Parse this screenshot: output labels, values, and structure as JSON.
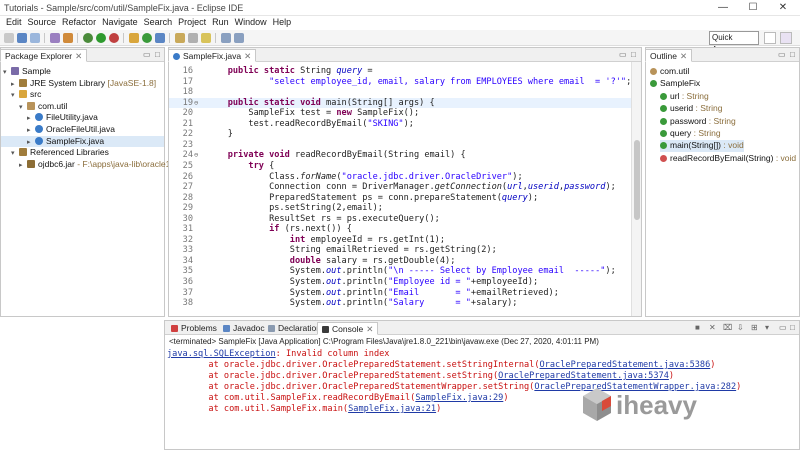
{
  "window": {
    "title": "Tutorials - Sample/src/com/util/SampleFix.java - Eclipse IDE",
    "controls": [
      "—",
      "☐",
      "✕"
    ]
  },
  "menu": [
    "Edit",
    "Source",
    "Refactor",
    "Navigate",
    "Search",
    "Project",
    "Run",
    "Window",
    "Help"
  ],
  "toolbar": {
    "quick_access": "Quick Access"
  },
  "package_explorer": {
    "tab_label": "Package Explorer",
    "tree": [
      {
        "toggle": "▾",
        "icon": "proj",
        "label": "Sample",
        "extra": ""
      },
      {
        "toggle": "▸",
        "icon": "lib",
        "label": "JRE System Library",
        "extra": "[JavaSE-1.8]"
      },
      {
        "toggle": "▾",
        "icon": "folder",
        "label": "src",
        "extra": ""
      },
      {
        "toggle": "▾",
        "icon": "pkg",
        "label": "com.util",
        "extra": ""
      },
      {
        "toggle": "▸",
        "icon": "java",
        "label": "FileUtility.java",
        "extra": ""
      },
      {
        "toggle": "▸",
        "icon": "java",
        "label": "OracleFileUtil.java",
        "extra": ""
      },
      {
        "toggle": "▸",
        "icon": "java",
        "label": "SampleFix.java",
        "extra": ""
      },
      {
        "toggle": "▾",
        "icon": "lib",
        "label": "Referenced Libraries",
        "extra": ""
      },
      {
        "toggle": "▸",
        "icon": "jar",
        "label": "ojdbc6.jar",
        "extra": "- F:\\apps\\java-lib\\oracle11g-j"
      }
    ]
  },
  "editor": {
    "tab_label": "SampleFix.java",
    "lines": [
      {
        "n": "16",
        "fold": "",
        "html": "    <span class=\"kw\">public static</span> String <span class=\"fld\">query</span> ="
      },
      {
        "n": "17",
        "fold": "",
        "html": "            <span class=\"str\">\"select employee_id, email, salary from EMPLOYEES where email  = '?'\"</span>;"
      },
      {
        "n": "18",
        "fold": "",
        "html": ""
      },
      {
        "n": "19",
        "fold": "⊖",
        "html": "    <span class=\"kw\">public static void</span> main(String[] args) {"
      },
      {
        "n": "20",
        "fold": "",
        "html": "        SampleFix test = <span class=\"kw\">new</span> SampleFix();"
      },
      {
        "n": "21",
        "fold": "",
        "html": "        test.readRecordByEmail(<span class=\"str\">\"SKING\"</span>);"
      },
      {
        "n": "22",
        "fold": "",
        "html": "    }"
      },
      {
        "n": "23",
        "fold": "",
        "html": ""
      },
      {
        "n": "24",
        "fold": "⊖",
        "html": "    <span class=\"kw\">private void</span> readRecordByEmail(String email) {"
      },
      {
        "n": "25",
        "fold": "",
        "html": "        <span class=\"kw\">try</span> {"
      },
      {
        "n": "26",
        "fold": "",
        "html": "            Class.<span class=\"ita\">forName</span>(<span class=\"str\">\"oracle.jdbc.driver.OracleDriver\"</span>);"
      },
      {
        "n": "27",
        "fold": "",
        "html": "            Connection conn = DriverManager.<span class=\"ita\">getConnection</span>(<span class=\"fld\">url</span>,<span class=\"fld\">userid</span>,<span class=\"fld\">password</span>);"
      },
      {
        "n": "28",
        "fold": "",
        "html": "            PreparedStatement ps = conn.prepareStatement(<span class=\"fld\">query</span>);"
      },
      {
        "n": "29",
        "fold": "",
        "html": "            ps.setString(2,email);"
      },
      {
        "n": "30",
        "fold": "",
        "html": "            ResultSet rs = ps.executeQuery();"
      },
      {
        "n": "31",
        "fold": "",
        "html": "            <span class=\"kw\">if</span> (rs.next()) {"
      },
      {
        "n": "32",
        "fold": "",
        "html": "                <span class=\"kw\">int</span> employeeId = rs.getInt(1);"
      },
      {
        "n": "33",
        "fold": "",
        "html": "                String emailRetrieved = rs.getString(2);"
      },
      {
        "n": "34",
        "fold": "",
        "html": "                <span class=\"kw\">double</span> salary = rs.getDouble(4);"
      },
      {
        "n": "35",
        "fold": "",
        "html": "                System.<span class=\"fld\">out</span>.println(<span class=\"str\">\"\\n ----- Select by Employee email  -----\"</span>);"
      },
      {
        "n": "36",
        "fold": "",
        "html": "                System.<span class=\"fld\">out</span>.println(<span class=\"str\">\"Employee id = \"</span>+employeeId);"
      },
      {
        "n": "37",
        "fold": "",
        "html": "                System.<span class=\"fld\">out</span>.println(<span class=\"str\">\"Email       = \"</span>+emailRetrieved);"
      },
      {
        "n": "38",
        "fold": "",
        "html": "                System.<span class=\"fld\">out</span>.println(<span class=\"str\">\"Salary      = \"</span>+salary);"
      }
    ]
  },
  "outline": {
    "tab_label": "Outline",
    "items": [
      {
        "label": "com.util",
        "type": "",
        "color": "#b8935a"
      },
      {
        "label": "SampleFix",
        "type": "",
        "color": "#3a9a3a"
      },
      {
        "label": "url",
        "type": ": String",
        "color": "#3a9a3a"
      },
      {
        "label": "userid",
        "type": ": String",
        "color": "#3a9a3a"
      },
      {
        "label": "password",
        "type": ": String",
        "color": "#3a9a3a"
      },
      {
        "label": "query",
        "type": ": String",
        "color": "#3a9a3a"
      },
      {
        "label": "main(String[])",
        "type": ": void",
        "color": "#3a9a3a"
      },
      {
        "label": "readRecordByEmail(String)",
        "type": ": void",
        "color": "#d05050"
      }
    ]
  },
  "bottom_tabs": [
    "Problems",
    "Javadoc",
    "Declaration",
    "Console"
  ],
  "console": {
    "terminated": "<terminated> SampleFix [Java Application] C:\\Program Files\\Java\\jre1.8.0_221\\bin\\javaw.exe (Dec 27, 2020, 4:01:11 PM)",
    "lines": [
      {
        "html": "<span class=\"link\">java.sql.SQLException</span>: Invalid column index"
      },
      {
        "html": "        at oracle.jdbc.driver.OraclePreparedStatement.setStringInternal(<span class=\"link\">OraclePreparedStatement.java:5386</span>)"
      },
      {
        "html": "        at oracle.jdbc.driver.OraclePreparedStatement.setString(<span class=\"link\">OraclePreparedStatement.java:5374</span>)"
      },
      {
        "html": "        at oracle.jdbc.driver.OraclePreparedStatementWrapper.setString(<span class=\"link\">OraclePreparedStatementWrapper.java:282</span>)"
      },
      {
        "html": "        at com.util.SampleFix.readRecordByEmail(<span class=\"link\">SampleFix.java:29</span>)"
      },
      {
        "html": "        at com.util.SampleFix.main(<span class=\"link\">SampleFix.java:21</span>)"
      }
    ]
  },
  "watermark": "iheavy"
}
